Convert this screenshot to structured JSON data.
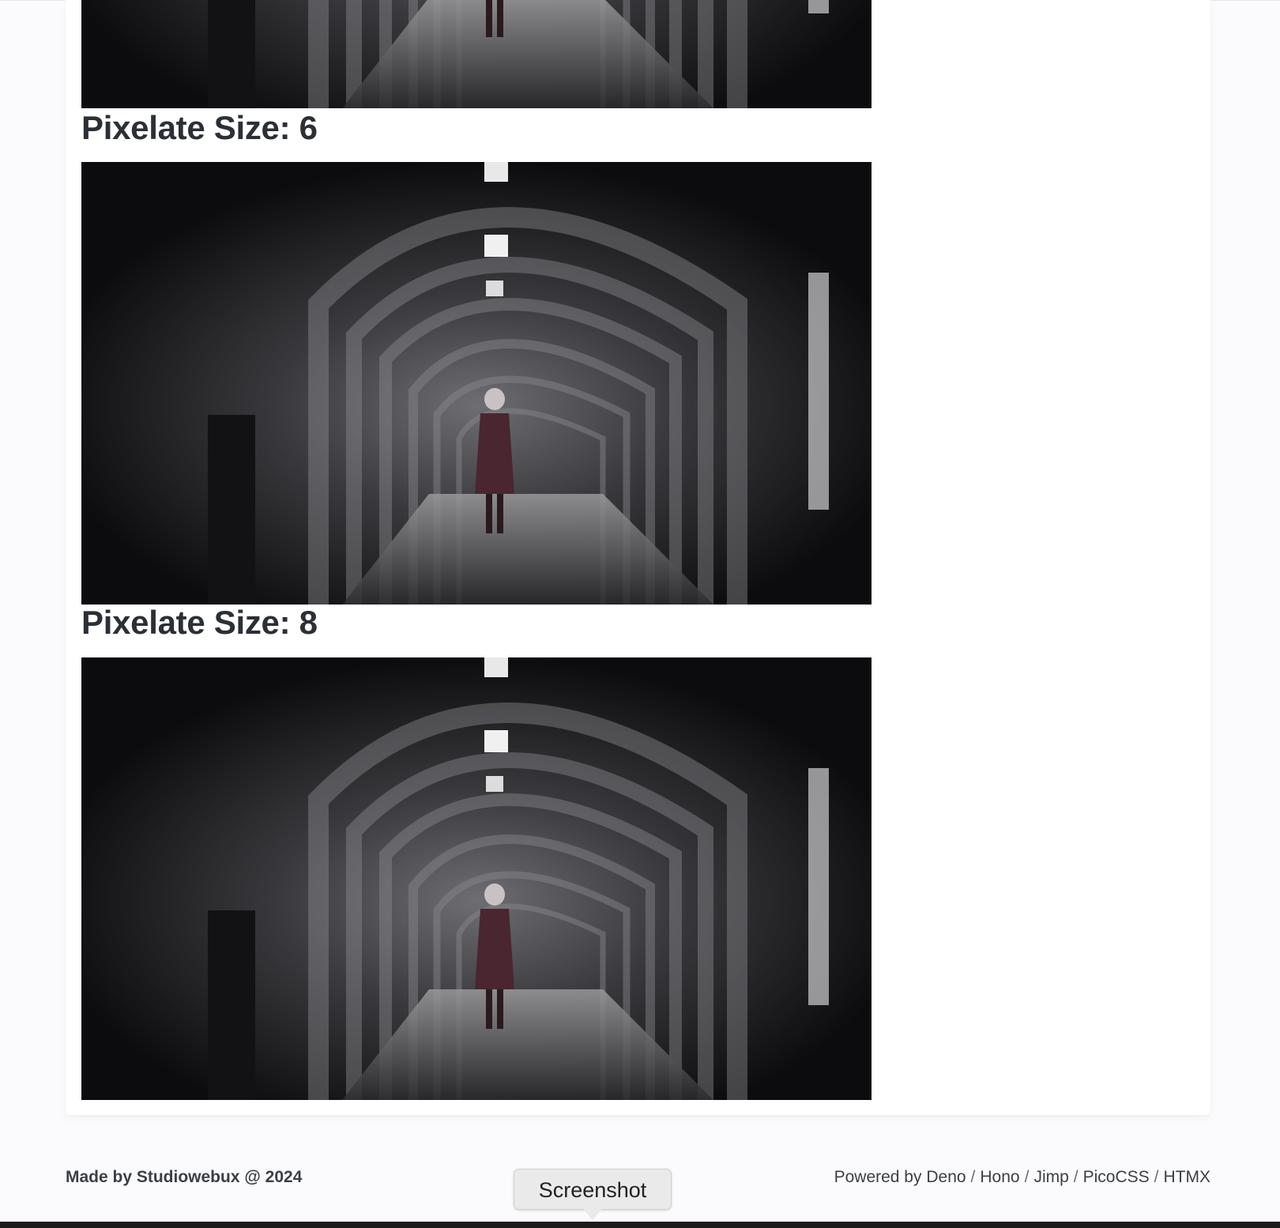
{
  "results": [
    {
      "heading": "Pixelate Size: 6",
      "image_alt": "Pixelated corridor image, size 6"
    },
    {
      "heading": "Pixelate Size: 8",
      "image_alt": "Pixelated corridor image, size 8"
    }
  ],
  "footer": {
    "left": "Made by Studiowebux @ 2024",
    "powered_by": "Powered by",
    "links": [
      "Deno",
      "Hono",
      "Jimp",
      "PicoCSS",
      "HTMX"
    ],
    "separator": "/"
  },
  "tooltip": "Screenshot",
  "colors": {
    "background": "#fbfbfd",
    "card": "#ffffff",
    "text": "#2b2f36"
  }
}
